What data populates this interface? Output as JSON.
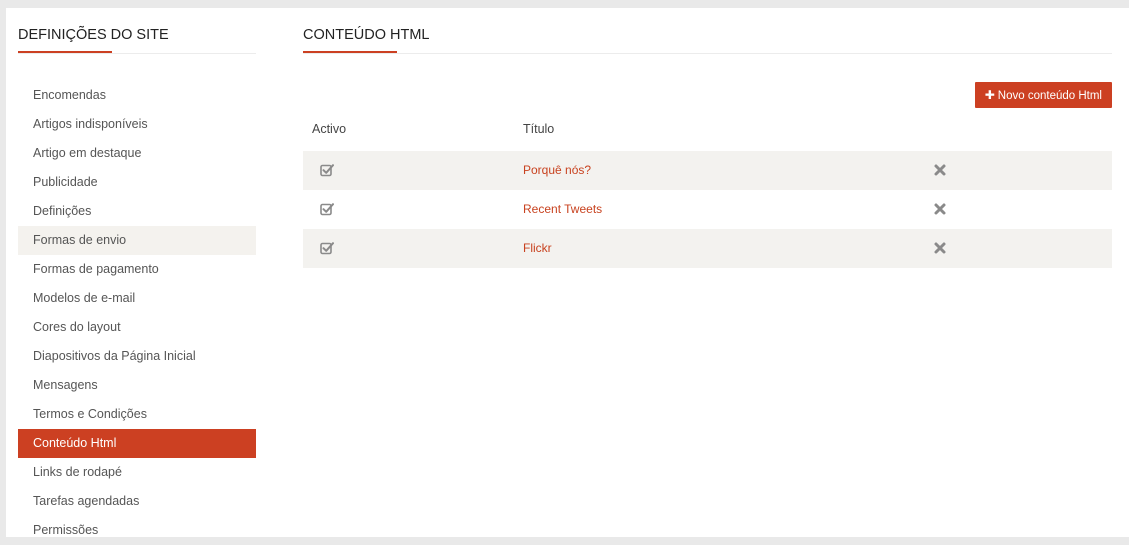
{
  "colors": {
    "accent": "#cc4022",
    "link": "#c8421f",
    "icon": "#8a8a8a"
  },
  "sidebar": {
    "title": "DEFINIÇÕES DO SITE",
    "items": [
      {
        "label": "Encomendas",
        "state": "normal"
      },
      {
        "label": "Artigos indisponíveis",
        "state": "normal"
      },
      {
        "label": "Artigo em destaque",
        "state": "normal"
      },
      {
        "label": "Publicidade",
        "state": "normal"
      },
      {
        "label": "Definições",
        "state": "normal"
      },
      {
        "label": "Formas de envio",
        "state": "hover"
      },
      {
        "label": "Formas de pagamento",
        "state": "normal"
      },
      {
        "label": "Modelos de e-mail",
        "state": "normal"
      },
      {
        "label": "Cores do layout",
        "state": "normal"
      },
      {
        "label": "Diapositivos da Página Inicial",
        "state": "normal"
      },
      {
        "label": "Mensagens",
        "state": "normal"
      },
      {
        "label": "Termos e Condições",
        "state": "normal"
      },
      {
        "label": "Conteúdo Html",
        "state": "active"
      },
      {
        "label": "Links de rodapé",
        "state": "normal"
      },
      {
        "label": "Tarefas agendadas",
        "state": "normal"
      },
      {
        "label": "Permissões",
        "state": "normal"
      }
    ]
  },
  "main": {
    "title": "CONTEÚDO HTML",
    "new_button": {
      "icon": "plus-icon",
      "label": "Novo conteúdo Html"
    },
    "table": {
      "headers": {
        "active": "Activo",
        "title": "Título"
      },
      "rows": [
        {
          "active": true,
          "title": "Porquê nós?"
        },
        {
          "active": true,
          "title": "Recent Tweets"
        },
        {
          "active": true,
          "title": "Flickr"
        }
      ]
    }
  }
}
